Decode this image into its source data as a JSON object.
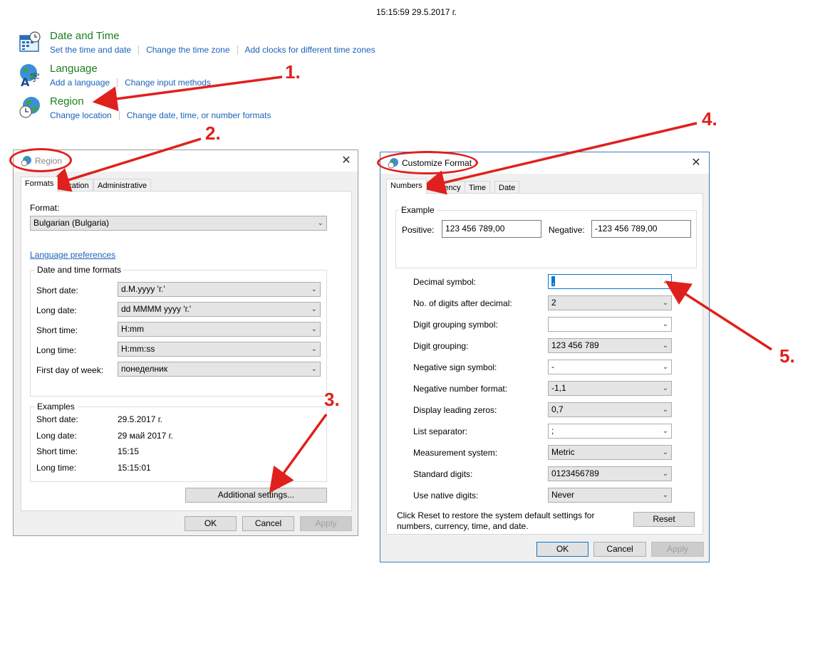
{
  "timestamp": "15:15:59 29.5.2017 г.",
  "control_panel": {
    "date_time": {
      "title": "Date and Time",
      "links": [
        "Set the time and date",
        "Change the time zone",
        "Add clocks for different time zones"
      ]
    },
    "language": {
      "title": "Language",
      "links": [
        "Add a language",
        "Change input methods"
      ]
    },
    "region": {
      "title": "Region",
      "links": [
        "Change location",
        "Change date, time, or number formats"
      ]
    }
  },
  "region_dialog": {
    "title": "Region",
    "tabs": [
      "Formats",
      "Location",
      "Administrative"
    ],
    "format_label": "Format:",
    "format_value": "Bulgarian (Bulgaria)",
    "language_preferences": "Language preferences",
    "date_time_group": "Date and time formats",
    "fields": [
      {
        "label": "Short date:",
        "value": "d.M.yyyy 'г.'"
      },
      {
        "label": "Long date:",
        "value": "dd MMMM yyyy 'г.'"
      },
      {
        "label": "Short time:",
        "value": "H:mm"
      },
      {
        "label": "Long time:",
        "value": "H:mm:ss"
      },
      {
        "label": "First day of week:",
        "value": "понеделник"
      }
    ],
    "examples_group": "Examples",
    "examples": [
      {
        "label": "Short date:",
        "value": "29.5.2017 г."
      },
      {
        "label": "Long date:",
        "value": "29 май 2017 г."
      },
      {
        "label": "Short time:",
        "value": "15:15"
      },
      {
        "label": "Long time:",
        "value": "15:15:01"
      }
    ],
    "additional_settings": "Additional settings...",
    "ok": "OK",
    "cancel": "Cancel",
    "apply": "Apply"
  },
  "customize_dialog": {
    "title": "Customize Format",
    "tabs": [
      "Numbers",
      "Currency",
      "Time",
      "Date"
    ],
    "example_group": "Example",
    "positive_label": "Positive:",
    "positive_value": "123 456 789,00",
    "negative_label": "Negative:",
    "negative_value": "-123 456 789,00",
    "settings": [
      {
        "label": "Decimal symbol:",
        "value": ","
      },
      {
        "label": "No. of digits after decimal:",
        "value": "2"
      },
      {
        "label": "Digit grouping symbol:",
        "value": ""
      },
      {
        "label": "Digit grouping:",
        "value": "123 456 789"
      },
      {
        "label": "Negative sign symbol:",
        "value": "-"
      },
      {
        "label": "Negative number format:",
        "value": "-1,1"
      },
      {
        "label": "Display leading zeros:",
        "value": "0,7"
      },
      {
        "label": "List separator:",
        "value": ";"
      },
      {
        "label": "Measurement system:",
        "value": "Metric"
      },
      {
        "label": "Standard digits:",
        "value": "0123456789"
      },
      {
        "label": "Use native digits:",
        "value": "Never"
      }
    ],
    "reset_note": "Click Reset to restore the system default settings for numbers, currency, time, and date.",
    "reset": "Reset",
    "ok": "OK",
    "cancel": "Cancel",
    "apply": "Apply"
  },
  "steps": [
    "1.",
    "2.",
    "3.",
    "4.",
    "5."
  ],
  "colors": {
    "accent_red": "#e0201c",
    "link_blue": "#1a62b8",
    "category_green": "#1e7d1e"
  },
  "icons": [
    "calendar-clock-icon",
    "language-globe-icon",
    "region-globe-clock-icon",
    "globe-small-icon",
    "chevron-down-icon",
    "close-icon"
  ]
}
